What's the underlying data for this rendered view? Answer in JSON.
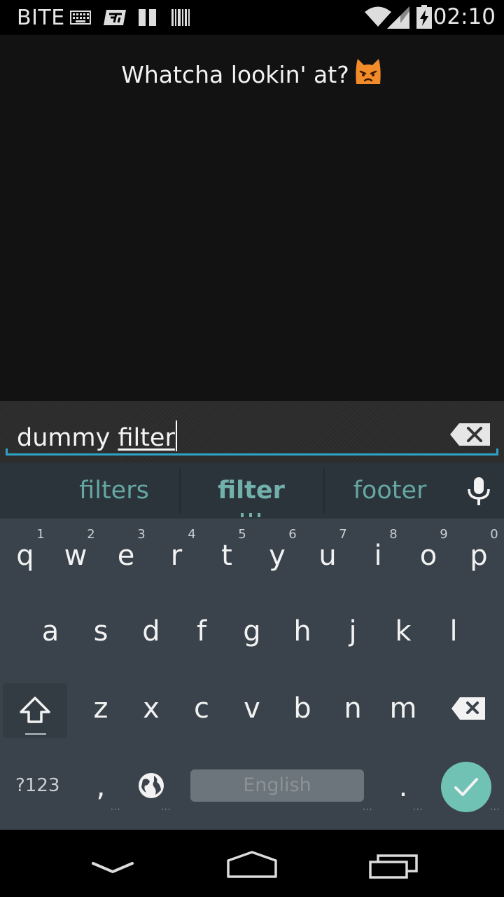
{
  "status_bar": {
    "carrier": "BITE",
    "time": "02:10",
    "icons": [
      "keyboard-icon",
      "app-notification-icon",
      "pause-icon",
      "barcode-icon",
      "wifi-icon",
      "signal-icon",
      "battery-charging-icon"
    ]
  },
  "app": {
    "toast_text": "Whatcha lookin' at?",
    "emoji": "pouting-cat-emoji"
  },
  "search": {
    "value_committed": "dummy ",
    "value_composing": "filter",
    "clear_icon": "backspace-clear-icon"
  },
  "suggestions": [
    {
      "label": "filters"
    },
    {
      "label": "filter"
    },
    {
      "label": "footer"
    }
  ],
  "keyboard": {
    "row1": [
      {
        "key": "q",
        "hint": "1"
      },
      {
        "key": "w",
        "hint": "2"
      },
      {
        "key": "e",
        "hint": "3"
      },
      {
        "key": "r",
        "hint": "4"
      },
      {
        "key": "t",
        "hint": "5"
      },
      {
        "key": "y",
        "hint": "6"
      },
      {
        "key": "u",
        "hint": "7"
      },
      {
        "key": "i",
        "hint": "8"
      },
      {
        "key": "o",
        "hint": "9"
      },
      {
        "key": "p",
        "hint": "0"
      }
    ],
    "row2": [
      "a",
      "s",
      "d",
      "f",
      "g",
      "h",
      "j",
      "k",
      "l"
    ],
    "row3": [
      "z",
      "x",
      "c",
      "v",
      "b",
      "n",
      "m"
    ],
    "symbols_label": "?123",
    "comma_label": ",",
    "period_label": ".",
    "space_label": "English",
    "colors": {
      "background": "#3a434b",
      "suggestion": "#66a7a3",
      "enter": "#6fc2b4"
    }
  },
  "nav_bar": {
    "icons": [
      "back-down-icon",
      "home-icon",
      "recents-icon"
    ]
  }
}
